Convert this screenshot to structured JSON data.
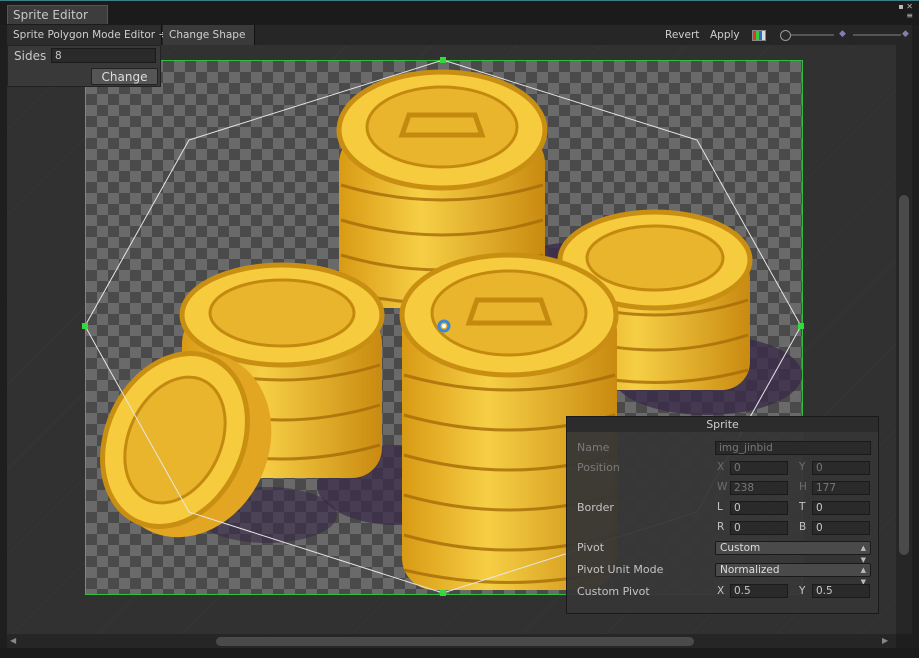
{
  "window": {
    "tab_title": "Sprite Editor",
    "controls": "▪ ✕\n≡"
  },
  "toolbar": {
    "mode_dropdown": "Sprite Polygon Mode Editor ÷",
    "change_shape": "Change Shape",
    "revert": "Revert",
    "apply": "Apply"
  },
  "sides_popup": {
    "label": "Sides",
    "value": "8",
    "change_button": "Change"
  },
  "sprite_panel": {
    "title": "Sprite",
    "name_label": "Name",
    "name_value": "img_jinbid",
    "position_label": "Position",
    "x_label": "X",
    "x_value": "0",
    "y_label": "Y",
    "y_value": "0",
    "w_label": "W",
    "w_value": "238",
    "h_label": "H",
    "h_value": "177",
    "border_label": "Border",
    "l_label": "L",
    "l_value": "0",
    "t_label": "T",
    "t_value": "0",
    "r_label": "R",
    "r_value": "0",
    "b_label": "B",
    "b_value": "0",
    "pivot_label": "Pivot",
    "pivot_value": "Custom",
    "pivot_unit_label": "Pivot Unit Mode",
    "pivot_unit_value": "Normalized",
    "custom_pivot_label": "Custom Pivot",
    "cp_x_label": "X",
    "cp_x_value": "0.5",
    "cp_y_label": "Y",
    "cp_y_value": "0.5"
  },
  "colors": {
    "outline": "#2fbf3a",
    "coin": "#f2c33a",
    "coin_dark": "#c98f12",
    "accent": "#3b7f8a"
  }
}
